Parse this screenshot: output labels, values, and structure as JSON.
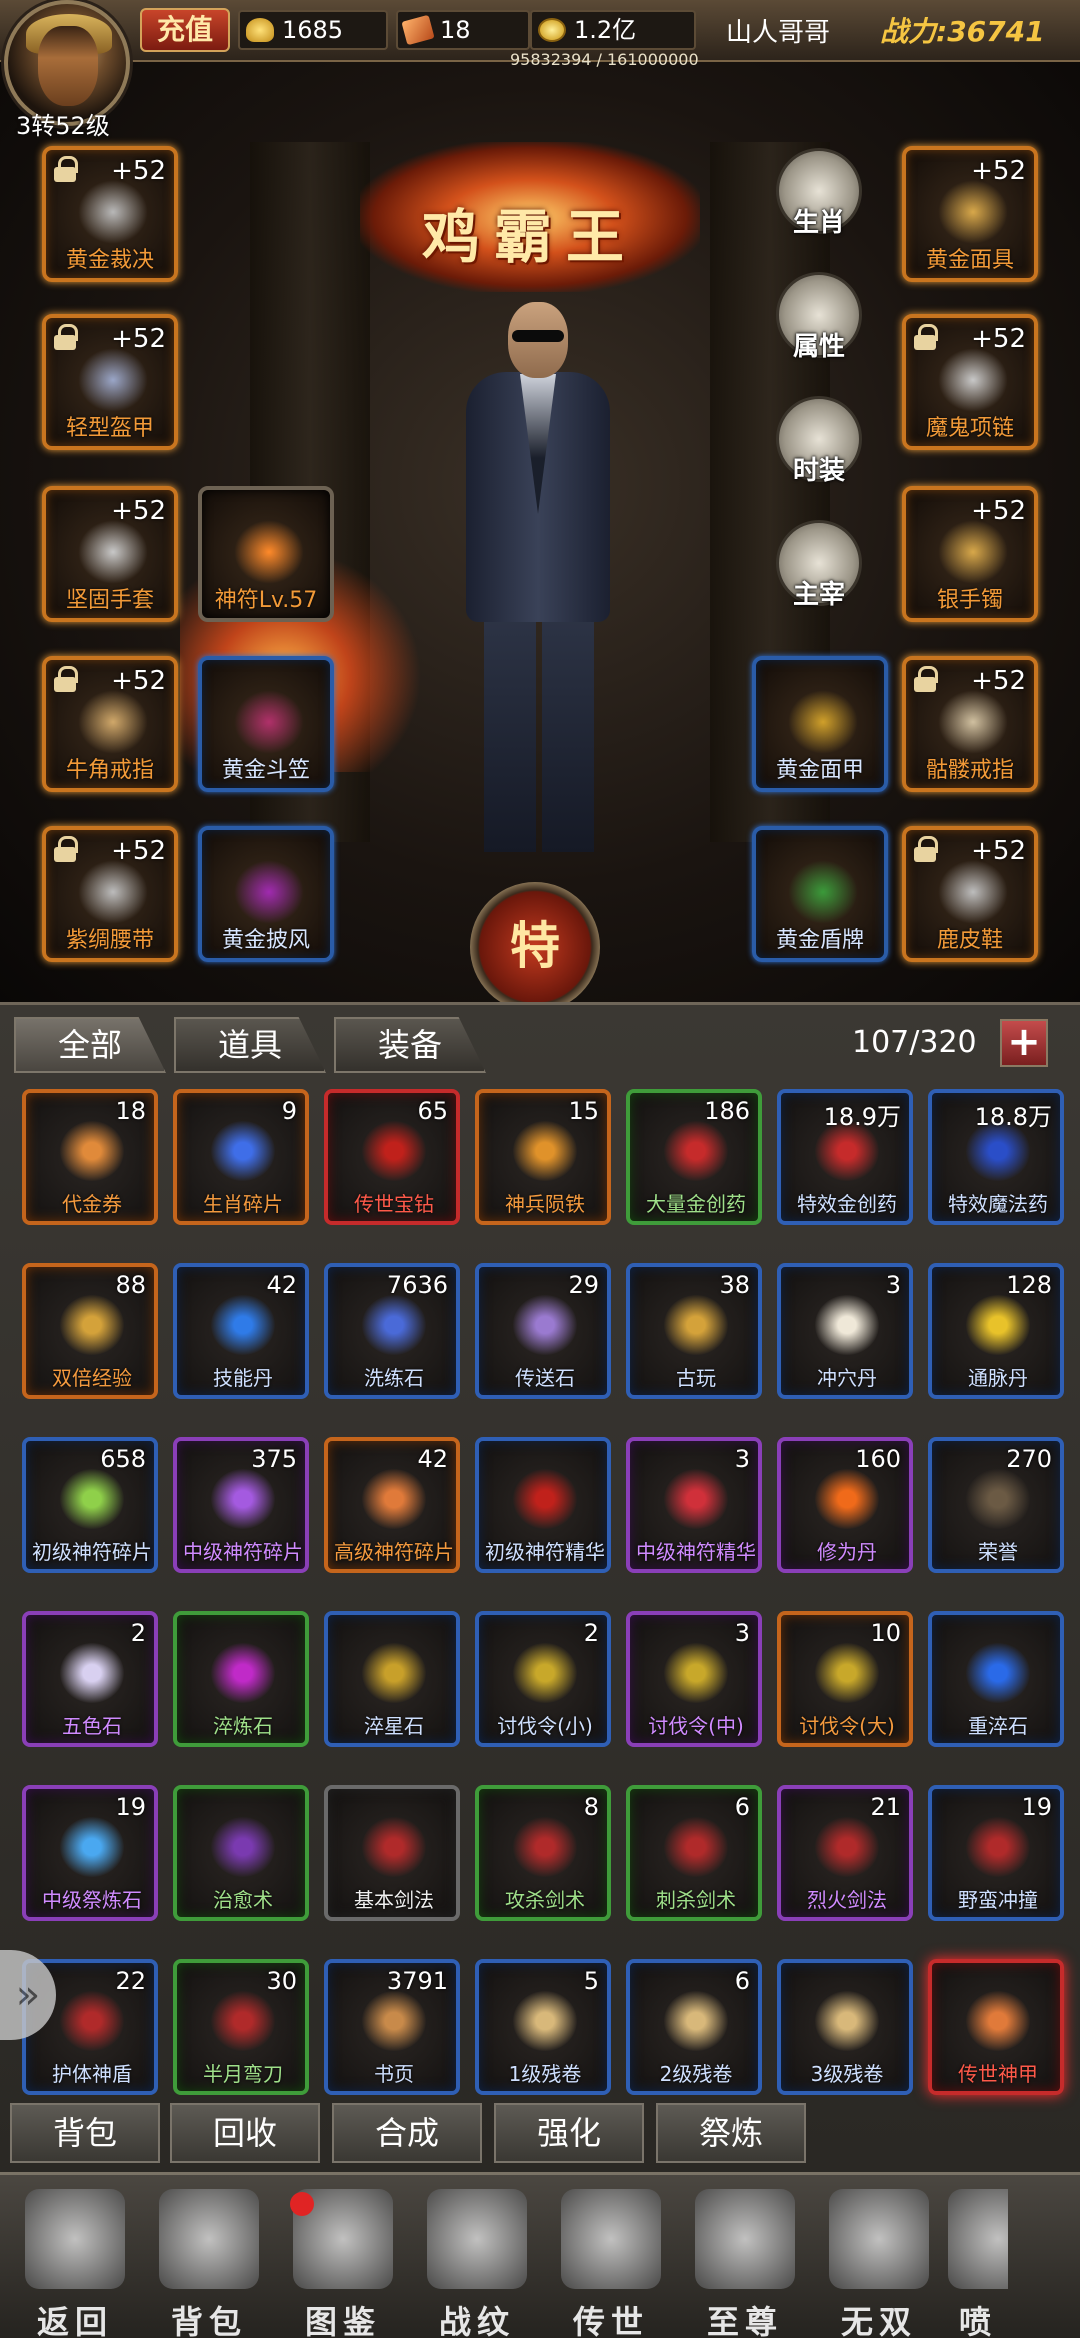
{
  "topbar": {
    "level": "3转52级",
    "recharge": "充值",
    "ingots": "1685",
    "tickets": "18",
    "gold": "1.2亿",
    "username": "山人哥哥",
    "power": "战力:36741",
    "exp_text": "95832394 / 161000000",
    "exp_fraction": 0.595
  },
  "stage": {
    "title": "鸡霸王",
    "special": "特",
    "side_buttons": [
      "生肖",
      "属性",
      "时装",
      "主宰"
    ]
  },
  "equipment": [
    {
      "name": "黄金裁决",
      "plus": "+52",
      "locked": true,
      "quality": "gold"
    },
    {
      "name": "轻型盔甲",
      "plus": "+52",
      "locked": true,
      "quality": "gold"
    },
    {
      "name": "坚固手套",
      "plus": "+52",
      "locked": false,
      "quality": "gold"
    },
    {
      "name": "牛角戒指",
      "plus": "+52",
      "locked": true,
      "quality": "gold"
    },
    {
      "name": "紫绸腰带",
      "plus": "+52",
      "locked": true,
      "quality": "gold"
    },
    {
      "name": "黄金面具",
      "plus": "+52",
      "locked": false,
      "quality": "gold"
    },
    {
      "name": "魔鬼项链",
      "plus": "+52",
      "locked": true,
      "quality": "gold"
    },
    {
      "name": "银手镯",
      "plus": "+52",
      "locked": false,
      "quality": "gold"
    },
    {
      "name": "骷髅戒指",
      "plus": "+52",
      "locked": true,
      "quality": "gold"
    },
    {
      "name": "鹿皮鞋",
      "plus": "+52",
      "locked": true,
      "quality": "gold"
    },
    {
      "name": "神符Lv.57",
      "plus": "",
      "locked": false,
      "quality": "gray"
    },
    {
      "name": "黄金斗笠",
      "plus": "",
      "locked": false,
      "quality": "blue"
    },
    {
      "name": "黄金披风",
      "plus": "",
      "locked": false,
      "quality": "blue"
    },
    {
      "name": "黄金面甲",
      "plus": "",
      "locked": false,
      "quality": "blue"
    },
    {
      "name": "黄金盾牌",
      "plus": "",
      "locked": false,
      "quality": "blue"
    }
  ],
  "inventory": {
    "tabs": [
      "全部",
      "道具",
      "装备"
    ],
    "count": "107/320",
    "add": "+",
    "items": [
      {
        "name": "代金券",
        "qty": "18",
        "q": "orange",
        "c": "#e08a3a"
      },
      {
        "name": "生肖碎片",
        "qty": "9",
        "q": "orange",
        "c": "#3f6ee8"
      },
      {
        "name": "传世宝钻",
        "qty": "65",
        "q": "red",
        "c": "#c0211b"
      },
      {
        "name": "神兵陨铁",
        "qty": "15",
        "q": "orange",
        "c": "#e0922a"
      },
      {
        "name": "大量金创药",
        "qty": "186",
        "q": "green",
        "c": "#c62b2b"
      },
      {
        "name": "特效金创药",
        "qty": "18.9万",
        "q": "blue",
        "c": "#c62b2b"
      },
      {
        "name": "特效魔法药",
        "qty": "18.8万",
        "q": "blue",
        "c": "#2a4ec8"
      },
      {
        "name": "双倍经验",
        "qty": "88",
        "q": "orange",
        "c": "#d4a23a"
      },
      {
        "name": "技能丹",
        "qty": "42",
        "q": "blue",
        "c": "#2f7be8"
      },
      {
        "name": "洗练石",
        "qty": "7636",
        "q": "blue",
        "c": "#4a6ad8"
      },
      {
        "name": "传送石",
        "qty": "29",
        "q": "blue",
        "c": "#9a7ad0"
      },
      {
        "name": "古玩",
        "qty": "38",
        "q": "blue",
        "c": "#d4a23a"
      },
      {
        "name": "冲穴丹",
        "qty": "3",
        "q": "blue",
        "c": "#efe8d8"
      },
      {
        "name": "通脉丹",
        "qty": "128",
        "q": "blue",
        "c": "#e8c22a"
      },
      {
        "name": "初级神符碎片",
        "qty": "658",
        "q": "blue",
        "c": "#8fd04a"
      },
      {
        "name": "中级神符碎片",
        "qty": "375",
        "q": "purple",
        "c": "#a45ae0"
      },
      {
        "name": "高级神符碎片",
        "qty": "42",
        "q": "orange",
        "c": "#e07a3a"
      },
      {
        "name": "初级神符精华",
        "qty": "",
        "q": "blue",
        "c": "#c0211b"
      },
      {
        "name": "中级神符精华",
        "qty": "3",
        "q": "purple",
        "c": "#d0303a"
      },
      {
        "name": "修为丹",
        "qty": "160",
        "q": "purple",
        "c": "#f06a1a"
      },
      {
        "name": "荣誉",
        "qty": "270",
        "q": "blue",
        "c": "#6b5a44"
      },
      {
        "name": "五色石",
        "qty": "2",
        "q": "purple",
        "c": "#d8d0f0"
      },
      {
        "name": "淬炼石",
        "qty": "",
        "q": "green",
        "c": "#c02ac8"
      },
      {
        "name": "淬星石",
        "qty": "",
        "q": "blue",
        "c": "#c8a02a"
      },
      {
        "name": "讨伐令(小)",
        "qty": "2",
        "q": "blue",
        "c": "#c8a82a"
      },
      {
        "name": "讨伐令(中)",
        "qty": "3",
        "q": "purple",
        "c": "#c8a82a"
      },
      {
        "name": "讨伐令(大)",
        "qty": "10",
        "q": "orange",
        "c": "#c8a82a"
      },
      {
        "name": "重淬石",
        "qty": "",
        "q": "blue",
        "c": "#2a6ae8"
      },
      {
        "name": "中级祭炼石",
        "qty": "19",
        "q": "purple",
        "c": "#4aa8f0"
      },
      {
        "name": "治愈术",
        "qty": "",
        "q": "green",
        "c": "#7a3ab0"
      },
      {
        "name": "基本剑法",
        "qty": "",
        "q": "white",
        "c": "#b02a2a"
      },
      {
        "name": "攻杀剑术",
        "qty": "8",
        "q": "green",
        "c": "#b02a2a"
      },
      {
        "name": "刺杀剑术",
        "qty": "6",
        "q": "green",
        "c": "#b02a2a"
      },
      {
        "name": "烈火剑法",
        "qty": "21",
        "q": "purple",
        "c": "#b02a2a"
      },
      {
        "name": "野蛮冲撞",
        "qty": "19",
        "q": "blue",
        "c": "#b02a2a"
      },
      {
        "name": "护体神盾",
        "qty": "22",
        "q": "blue",
        "c": "#b02a2a"
      },
      {
        "name": "半月弯刀",
        "qty": "30",
        "q": "green",
        "c": "#b02a2a"
      },
      {
        "name": "书页",
        "qty": "3791",
        "q": "blue",
        "c": "#c88a4a"
      },
      {
        "name": "1级残卷",
        "qty": "5",
        "q": "blue",
        "c": "#d8b87a"
      },
      {
        "name": "2级残卷",
        "qty": "6",
        "q": "blue",
        "c": "#d8b87a"
      },
      {
        "name": "3级残卷",
        "qty": "",
        "q": "blue",
        "c": "#d8b87a"
      },
      {
        "name": "传世神甲",
        "qty": "",
        "q": "red",
        "c": "#e07a3a"
      }
    ],
    "sub_buttons": [
      "背包",
      "回收",
      "合成",
      "强化",
      "祭炼"
    ],
    "handle": "»"
  },
  "nav": [
    "返回",
    "背包",
    "图鉴",
    "战纹",
    "传世",
    "至尊",
    "无双",
    "喷"
  ]
}
